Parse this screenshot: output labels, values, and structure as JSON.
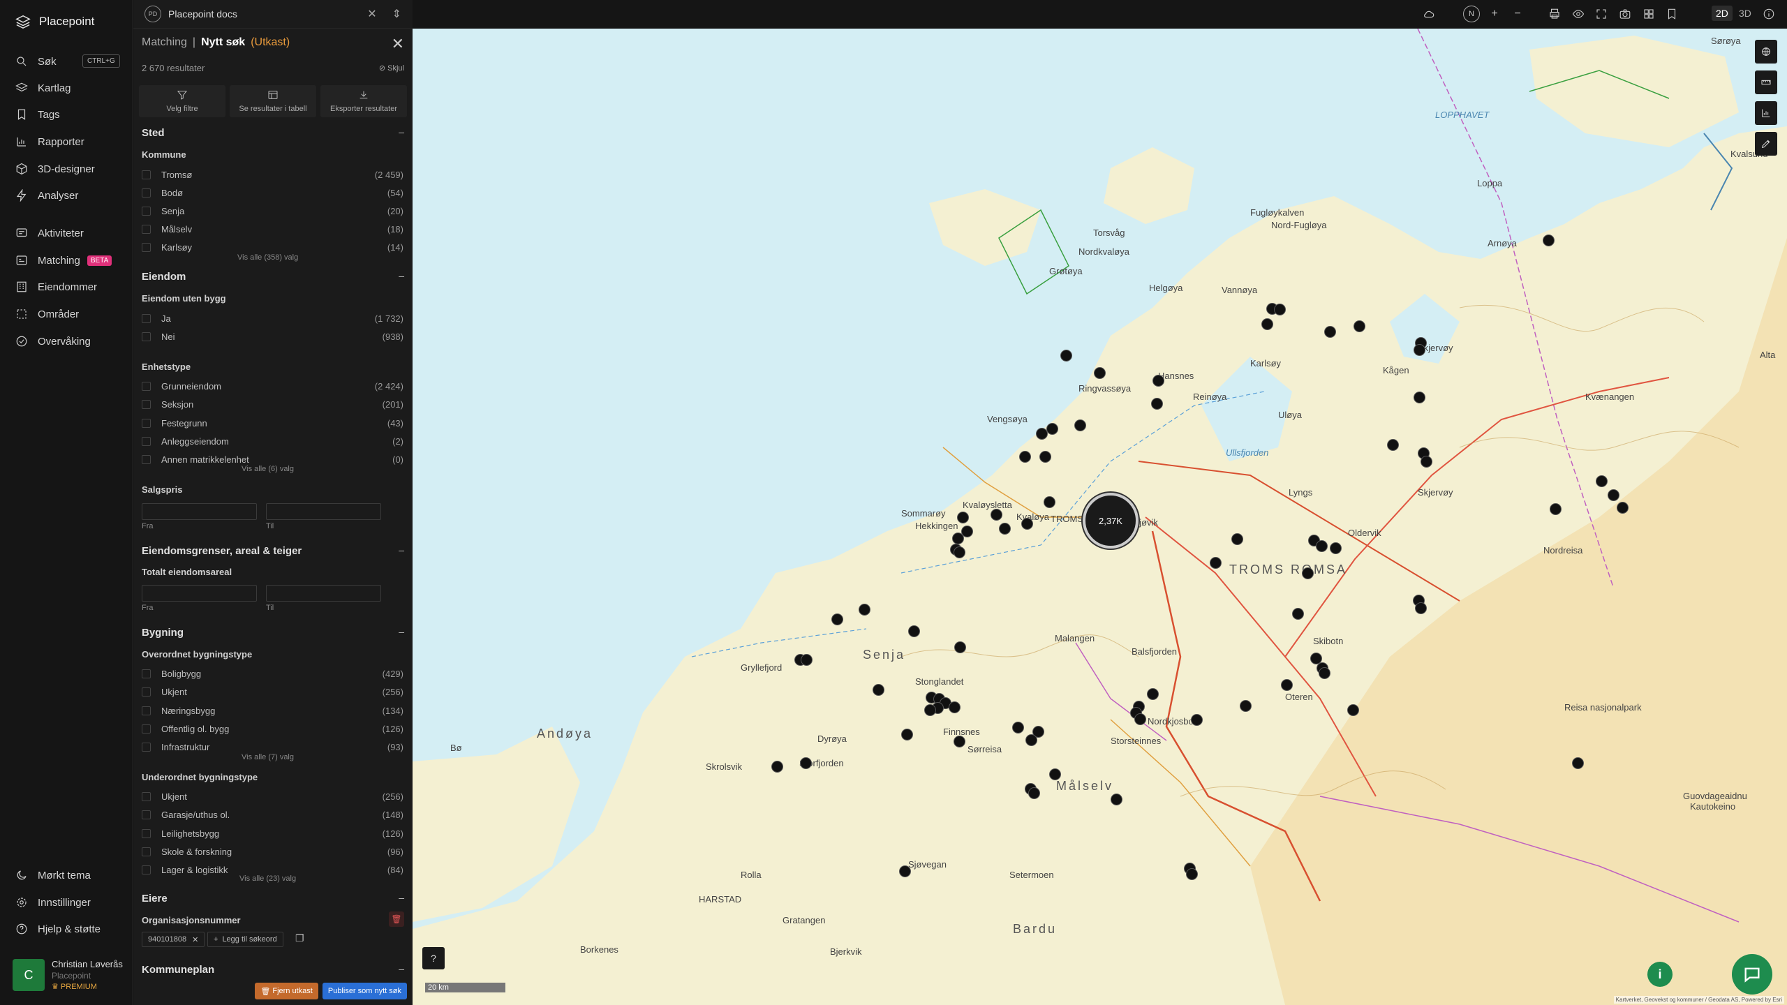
{
  "app": {
    "name": "Placepoint"
  },
  "nav": {
    "search": "Søk",
    "search_shortcut": "CTRL+G",
    "items": [
      "Kartlag",
      "Tags",
      "Rapporter",
      "3D-designer",
      "Analyser"
    ],
    "items2": [
      "Aktiviteter",
      "Matching",
      "Eiendommer",
      "Områder",
      "Overvåking"
    ],
    "beta": "BETA",
    "bottom": [
      "Mørkt tema",
      "Innstillinger",
      "Hjelp & støtte"
    ]
  },
  "user": {
    "initial": "C",
    "name": "Christian Løverås",
    "org": "Placepoint",
    "plan": "PREMIUM"
  },
  "workspace": {
    "badge": "PD",
    "name": "Placepoint docs"
  },
  "panel": {
    "crumb_parent": "Matching",
    "crumb_sep": "|",
    "crumb_current": "Nytt søk",
    "crumb_status": "(Utkast)",
    "result_count": "2 670 resultater",
    "hide_label": "Skjul",
    "actions": [
      "Velg filtre",
      "Se resultater i tabell",
      "Eksporter resultater"
    ],
    "sections": {
      "sted": {
        "title": "Sted",
        "group": "Kommune",
        "rows": [
          {
            "label": "Tromsø",
            "count": "(2 459)"
          },
          {
            "label": "Bodø",
            "count": "(54)"
          },
          {
            "label": "Senja",
            "count": "(20)"
          },
          {
            "label": "Målselv",
            "count": "(18)"
          },
          {
            "label": "Karlsøy",
            "count": "(14)"
          }
        ],
        "more": "Vis alle (358) valg"
      },
      "eiendom": {
        "title": "Eiendom",
        "group1": "Eiendom uten bygg",
        "rows1": [
          {
            "label": "Ja",
            "count": "(1 732)"
          },
          {
            "label": "Nei",
            "count": "(938)"
          }
        ],
        "group2": "Enhetstype",
        "rows2": [
          {
            "label": "Grunneiendom",
            "count": "(2 424)"
          },
          {
            "label": "Seksjon",
            "count": "(201)"
          },
          {
            "label": "Festegrunn",
            "count": "(43)"
          },
          {
            "label": "Anleggseiendom",
            "count": "(2)"
          },
          {
            "label": "Annen matrikkelenhet",
            "count": "(0)"
          }
        ],
        "more": "Vis alle (6) valg",
        "group3": "Salgspris",
        "from": "Fra",
        "to": "Til"
      },
      "grenser": {
        "title": "Eiendomsgrenser, areal & teiger",
        "group": "Totalt eiendomsareal",
        "from": "Fra",
        "to": "Til"
      },
      "bygning": {
        "title": "Bygning",
        "group1": "Overordnet bygningstype",
        "rows1": [
          {
            "label": "Boligbygg",
            "count": "(429)"
          },
          {
            "label": "Ukjent",
            "count": "(256)"
          },
          {
            "label": "Næringsbygg",
            "count": "(134)"
          },
          {
            "label": "Offentlig ol. bygg",
            "count": "(126)"
          },
          {
            "label": "Infrastruktur",
            "count": "(93)"
          }
        ],
        "more1": "Vis alle (7) valg",
        "group2": "Underordnet bygningstype",
        "rows2": [
          {
            "label": "Ukjent",
            "count": "(256)"
          },
          {
            "label": "Garasje/uthus ol.",
            "count": "(148)"
          },
          {
            "label": "Leilighetsbygg",
            "count": "(126)"
          },
          {
            "label": "Skole & forskning",
            "count": "(96)"
          },
          {
            "label": "Lager & logistikk",
            "count": "(84)"
          }
        ],
        "more2": "Vis alle (23) valg"
      },
      "eiere": {
        "title": "Eiere",
        "group": "Organisasjonsnummer",
        "tag": "940101808",
        "add": "Legg til søkeord"
      },
      "kommuneplan": {
        "title": "Kommuneplan"
      }
    },
    "remove_draft": "Fjern utkast",
    "publish": "Publiser som nytt søk"
  },
  "topbar": {
    "north": "N",
    "mode_2d": "2D",
    "mode_3d": "3D"
  },
  "map": {
    "cluster_label": "2,37K",
    "scale": "20 km",
    "attribution": "Kartverket, Geovekst og kommuner / Geodata AS, Powered by Esri",
    "places": [
      "LOPPHAVET",
      "Sørøya",
      "Loppa",
      "Arnøya",
      "Nordkvaløya",
      "Ringvassøya",
      "Vannøya",
      "Reinøya",
      "Uløya",
      "Kvænangen",
      "Skjervøy",
      "Kågen",
      "Lyngs",
      "Ullsfjorden",
      "Fugløykalven",
      "Nord-Fugløya",
      "Grøtøya",
      "Helgøya",
      "Hansnes",
      "Karlsøy",
      "Vengsøya",
      "Kvaløya",
      "TROMSØ",
      "TROMS ROMSA",
      "Senja",
      "Andøya",
      "Målselv",
      "Bardu",
      "HARSTAD",
      "Dyrøya",
      "Storfjorden",
      "Nordreisa",
      "Kautokeino",
      "Guovdageaidnu",
      "Skibotn",
      "Oteren",
      "Skjervøy",
      "Alta",
      "Gryllefjord",
      "Finnsnes",
      "Sjøvegan",
      "Setermoen",
      "Rolla",
      "Sørreisa",
      "Bjerkvik",
      "Balsfjorden",
      "Storsteinnes",
      "Nordkjosbotn",
      "Oldervik",
      "Hekkingen",
      "Sommarøy",
      "Kvaløysletta",
      "Malangen",
      "Stonglandet",
      "Borkenes",
      "Gratangen",
      "Bø",
      "Skrolsvik",
      "Torsvåg",
      "Nordskjøvik",
      "Kvalsund",
      "Reisa nasjonalpark"
    ]
  }
}
